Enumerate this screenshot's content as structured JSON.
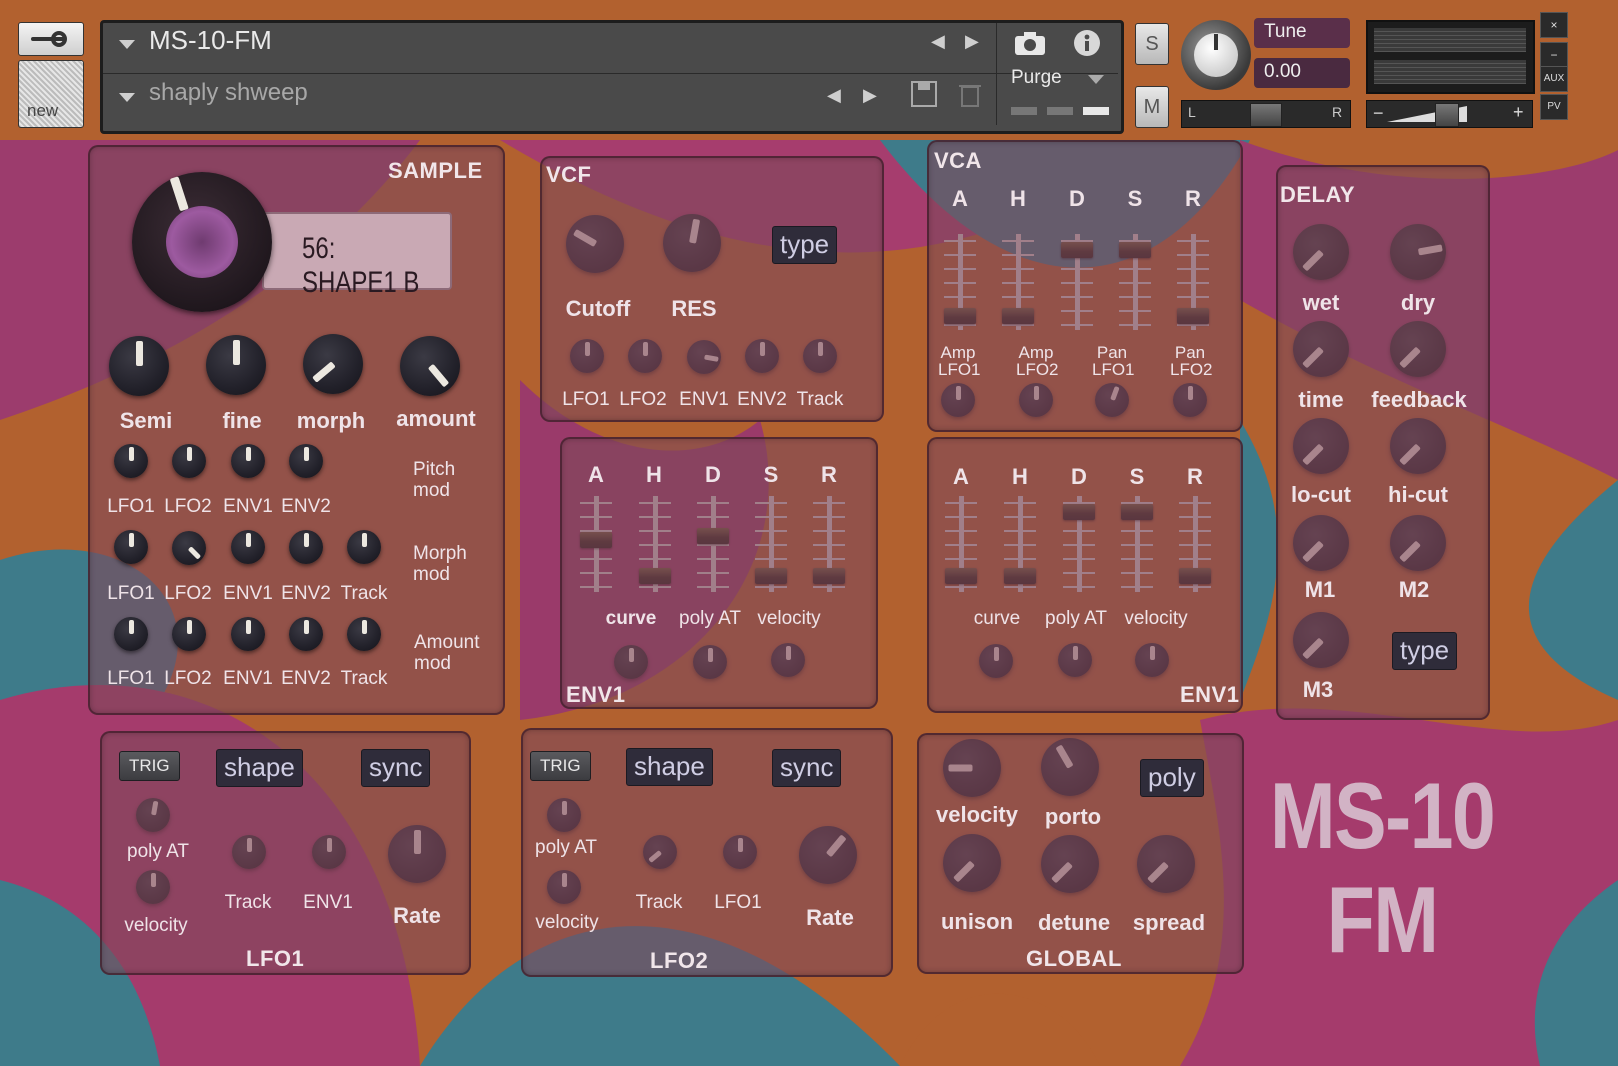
{
  "header": {
    "instrument_name": "MS-10-FM",
    "snapshot_name": "shaply shweep",
    "purge_label": "Purge",
    "tune_label": "Tune",
    "tune_value": "0.00",
    "solo_label": "S",
    "mute_label": "M",
    "new_label": "new",
    "pan_left": "L",
    "pan_right": "R",
    "vol_minus": "−",
    "vol_plus": "+",
    "aux_label": "AUX",
    "pv_label": "PV",
    "close_label": "×",
    "minimize_label": "−"
  },
  "sample": {
    "title": "SAMPLE",
    "display": "56: SHAPE1 B",
    "knobs": [
      "Semi",
      "fine",
      "morph",
      "amount"
    ],
    "pitch_mod": {
      "label": "Pitch mod",
      "knobs": [
        "LFO1",
        "LFO2",
        "ENV1",
        "ENV2"
      ]
    },
    "morph_mod": {
      "label": "Morph mod",
      "knobs": [
        "LFO1",
        "LFO2",
        "ENV1",
        "ENV2",
        "Track"
      ]
    },
    "amount_mod": {
      "label": "Amount mod",
      "knobs": [
        "LFO1",
        "LFO2",
        "ENV1",
        "ENV2",
        "Track"
      ]
    }
  },
  "vcf": {
    "title": "VCF",
    "cutoff": "Cutoff",
    "res": "RES",
    "type": "type",
    "mods": [
      "LFO1",
      "LFO2",
      "ENV1",
      "ENV2",
      "Track"
    ]
  },
  "vca": {
    "title": "VCA",
    "faders": [
      "A",
      "H",
      "D",
      "S",
      "R"
    ],
    "mods": [
      "Amp LFO1",
      "Amp LFO2",
      "Pan LFO1",
      "Pan LFO2"
    ]
  },
  "env1_left": {
    "title": "ENV1",
    "faders": [
      "A",
      "H",
      "D",
      "S",
      "R"
    ],
    "knobs": [
      "curve",
      "poly AT",
      "velocity"
    ]
  },
  "env1_right": {
    "title": "ENV1",
    "faders": [
      "A",
      "H",
      "D",
      "S",
      "R"
    ],
    "knobs": [
      "curve",
      "poly AT",
      "velocity"
    ]
  },
  "delay": {
    "title": "DELAY",
    "knobs": [
      "wet",
      "dry",
      "time",
      "feedback",
      "lo-cut",
      "hi-cut",
      "M1",
      "M2",
      "M3"
    ],
    "type": "type"
  },
  "lfo1": {
    "title": "LFO1",
    "trig": "TRIG",
    "shape": "shape",
    "sync": "sync",
    "knobs": [
      "poly AT",
      "velocity",
      "Track",
      "ENV1",
      "Rate"
    ]
  },
  "lfo2": {
    "title": "LFO2",
    "trig": "TRIG",
    "shape": "shape",
    "sync": "sync",
    "knobs": [
      "poly AT",
      "velocity",
      "Track",
      "LFO1",
      "Rate"
    ]
  },
  "global": {
    "title": "GLOBAL",
    "poly": "poly",
    "knobs": [
      "velocity",
      "porto",
      "unison",
      "detune",
      "spread"
    ]
  },
  "brand": {
    "line1": "MS-10",
    "line2": "FM"
  },
  "colors": {
    "panel": "#80485a",
    "knob": "#22212a",
    "background_orange": "#b0602e",
    "background_magenta": "#9e3a6e",
    "background_teal": "#3f7a88"
  }
}
